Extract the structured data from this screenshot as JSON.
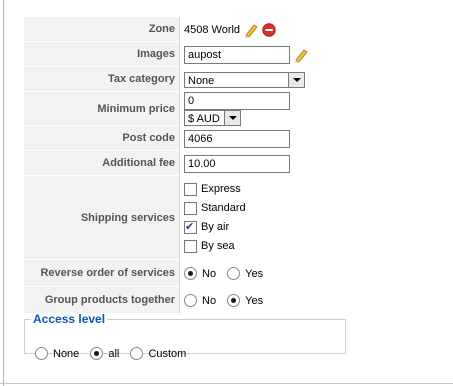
{
  "form": {
    "zone": {
      "label": "Zone",
      "value": "4508 World"
    },
    "images": {
      "label": "Images",
      "value": "aupost"
    },
    "tax_category": {
      "label": "Tax category",
      "selected": "None"
    },
    "minimum_price": {
      "label": "Minimum price",
      "value": "0",
      "currency": "$ AUD"
    },
    "post_code": {
      "label": "Post code",
      "value": "4066"
    },
    "additional_fee": {
      "label": "Additional fee",
      "value": "10.00"
    },
    "shipping_services": {
      "label": "Shipping services",
      "options": [
        {
          "label": "Express",
          "checked": false
        },
        {
          "label": "Standard",
          "checked": false
        },
        {
          "label": "By air",
          "checked": true
        },
        {
          "label": "By sea",
          "checked": false
        }
      ]
    },
    "reverse_order": {
      "label": "Reverse order of services",
      "options": [
        "No",
        "Yes"
      ],
      "selected": "No"
    },
    "group_products": {
      "label": "Group products together",
      "options": [
        "No",
        "Yes"
      ],
      "selected": "Yes"
    }
  },
  "access_level": {
    "legend": "Access level",
    "options": [
      "None",
      "all",
      "Custom"
    ],
    "selected": "all"
  },
  "icons": {
    "edit": "pencil-icon",
    "delete": "delete-icon"
  },
  "colors": {
    "legend": "#0b55c4",
    "label_bg": "#f2f2f2",
    "delete": "#d9302a"
  }
}
